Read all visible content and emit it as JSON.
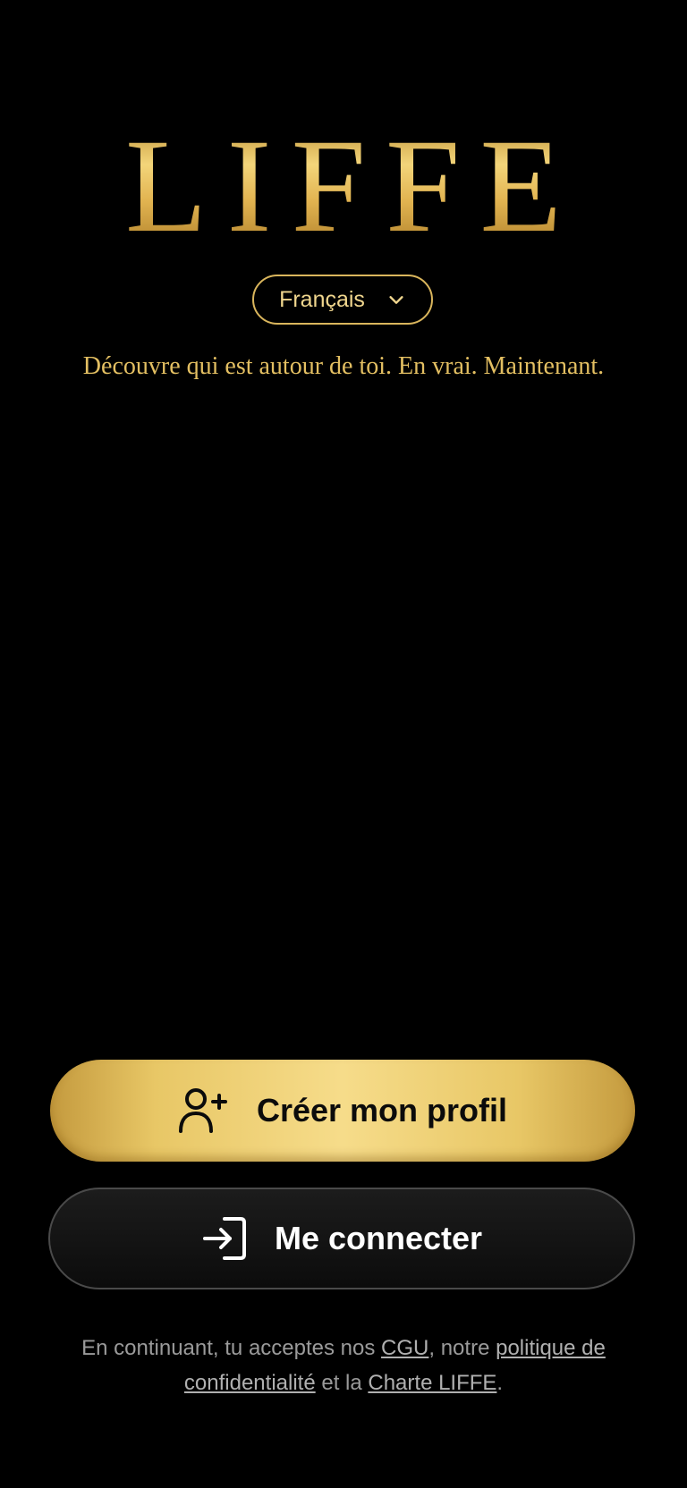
{
  "brand": {
    "logo_text": "LIFFE"
  },
  "language_selector": {
    "label": "Français",
    "icon": "chevron-down-icon"
  },
  "tagline": "Découvre qui est autour de toi. En vrai. Maintenant.",
  "actions": {
    "create_profile": {
      "label": "Créer mon profil",
      "icon": "add-user-icon"
    },
    "login": {
      "label": "Me connecter",
      "icon": "login-icon"
    }
  },
  "legal": {
    "prefix": "En continuant, tu acceptes nos ",
    "cgu_link": "CGU",
    "middle": ", notre ",
    "privacy_link": "politique de confidentialité",
    "and": " et la ",
    "charter_link": "Charte LIFFE",
    "suffix": "."
  },
  "colors": {
    "background": "#000000",
    "gold": "#e3bf62",
    "gold_light": "#f6dc8a",
    "muted_text": "#9a9a9a"
  }
}
